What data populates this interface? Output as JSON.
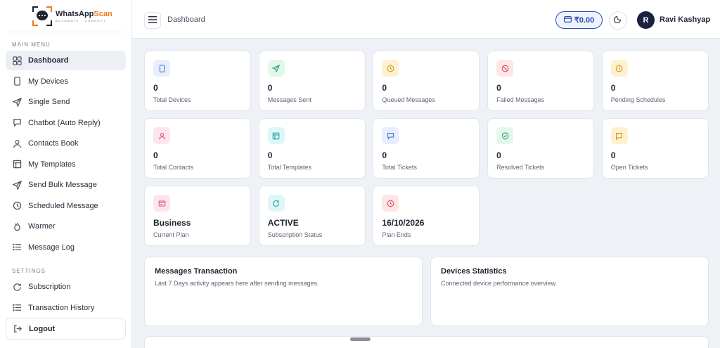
{
  "brand": {
    "name_part1": "WhatsApp",
    "name_part2": "Scan",
    "tagline": "AUTOMATE · CONNECT"
  },
  "sidebar": {
    "main_label": "MAIN MENU",
    "settings_label": "SETTINGS",
    "items": [
      {
        "label": "Dashboard",
        "icon": "grid-icon",
        "active": true
      },
      {
        "label": "My Devices",
        "icon": "phone-icon"
      },
      {
        "label": "Single Send",
        "icon": "send-icon"
      },
      {
        "label": "Chatbot (Auto Reply)",
        "icon": "chat-icon"
      },
      {
        "label": "Contacts Book",
        "icon": "user-icon"
      },
      {
        "label": "My Templates",
        "icon": "template-icon"
      },
      {
        "label": "Send Bulk Message",
        "icon": "send-icon"
      },
      {
        "label": "Scheduled Message",
        "icon": "clock-icon"
      },
      {
        "label": "Warmer",
        "icon": "flame-icon"
      },
      {
        "label": "Message Log",
        "icon": "list-icon"
      }
    ],
    "settings_items": [
      {
        "label": "Subscription",
        "icon": "refresh-icon"
      },
      {
        "label": "Transaction History",
        "icon": "list-icon"
      }
    ],
    "logout_label": "Logout"
  },
  "header": {
    "breadcrumb": "Dashboard",
    "wallet_balance": "₹0.00",
    "user_initial": "R",
    "user_name": "Ravi Kashyap"
  },
  "stats": [
    {
      "value": "0",
      "label": "Total Devices",
      "icon": "phone-icon",
      "bg": "#e8eefc",
      "fg": "#4a6cd4"
    },
    {
      "value": "0",
      "label": "Messages Sent",
      "icon": "send-icon",
      "bg": "#e3f7ef",
      "fg": "#25a36b"
    },
    {
      "value": "0",
      "label": "Queued Messages",
      "icon": "clock-icon",
      "bg": "#fdf1cf",
      "fg": "#c9950f"
    },
    {
      "value": "0",
      "label": "Failed Messages",
      "icon": "ban-icon",
      "bg": "#fde5e8",
      "fg": "#d94155"
    },
    {
      "value": "0",
      "label": "Pending Schedules",
      "icon": "clock-icon",
      "bg": "#fdf1cf",
      "fg": "#c9950f"
    },
    {
      "value": "0",
      "label": "Total Contacts",
      "icon": "user-icon",
      "bg": "#fde5ef",
      "fg": "#d94f86"
    },
    {
      "value": "0",
      "label": "Total Templates",
      "icon": "template-icon",
      "bg": "#dff6f6",
      "fg": "#1f9d9d"
    },
    {
      "value": "0",
      "label": "Total Tickets",
      "icon": "chat-icon",
      "bg": "#e8eefc",
      "fg": "#4a6cd4"
    },
    {
      "value": "0",
      "label": "Resolved Tickets",
      "icon": "shield-check-icon",
      "bg": "#e3f7ef",
      "fg": "#25a36b"
    },
    {
      "value": "0",
      "label": "Open Tickets",
      "icon": "chat-square-icon",
      "bg": "#fdf1cf",
      "fg": "#c9950f"
    },
    {
      "value": "Business",
      "label": "Current Plan",
      "icon": "card-icon",
      "bg": "#fde5ef",
      "fg": "#d94f86"
    },
    {
      "value": "ACTIVE",
      "label": "Subscription Status",
      "icon": "refresh-icon",
      "bg": "#dff6f6",
      "fg": "#1f9d9d"
    },
    {
      "value": "16/10/2026",
      "label": "Plan Ends",
      "icon": "clock-icon",
      "bg": "#fde5e8",
      "fg": "#d94155"
    }
  ],
  "panels": {
    "transactions": {
      "title": "Messages Transaction",
      "subtitle": "Last 7 Days activity appears here after sending messages."
    },
    "devices": {
      "title": "Devices Statistics",
      "subtitle": "Connected device performance overview."
    }
  }
}
